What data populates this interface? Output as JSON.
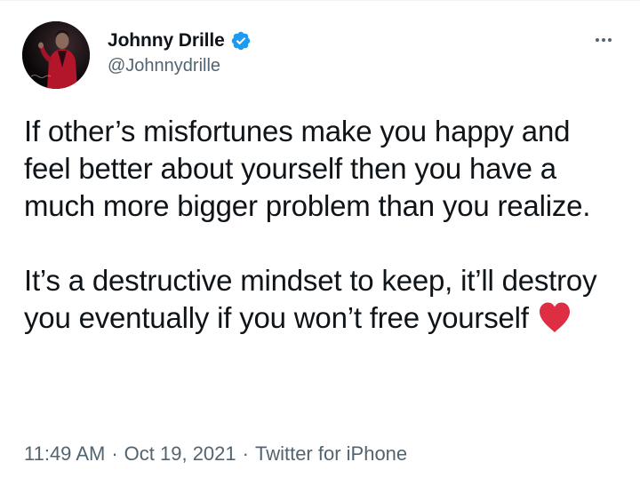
{
  "tweet": {
    "author": {
      "display_name": "Johnny Drille",
      "handle": "@Johnnydrille",
      "verified": true,
      "verified_icon": "verified-badge-icon"
    },
    "more_icon": "more-options-icon",
    "text": {
      "paragraph_1": "If other’s misfortunes make you happy and feel better about yourself then you have a much more bigger problem than you realize.",
      "paragraph_2": "It’s a destructive mindset to keep, it’ll destroy you eventually if you won’t free yourself",
      "emoji": "red-heart-icon"
    },
    "timestamp": {
      "time": "11:49 AM",
      "date": "Oct 19, 2021",
      "source": "Twitter for iPhone",
      "separator": "·"
    }
  },
  "colors": {
    "text_primary": "#0f1419",
    "text_secondary": "#536471",
    "verified_blue": "#1d9bf0",
    "heart_red": "#dd2e44"
  }
}
